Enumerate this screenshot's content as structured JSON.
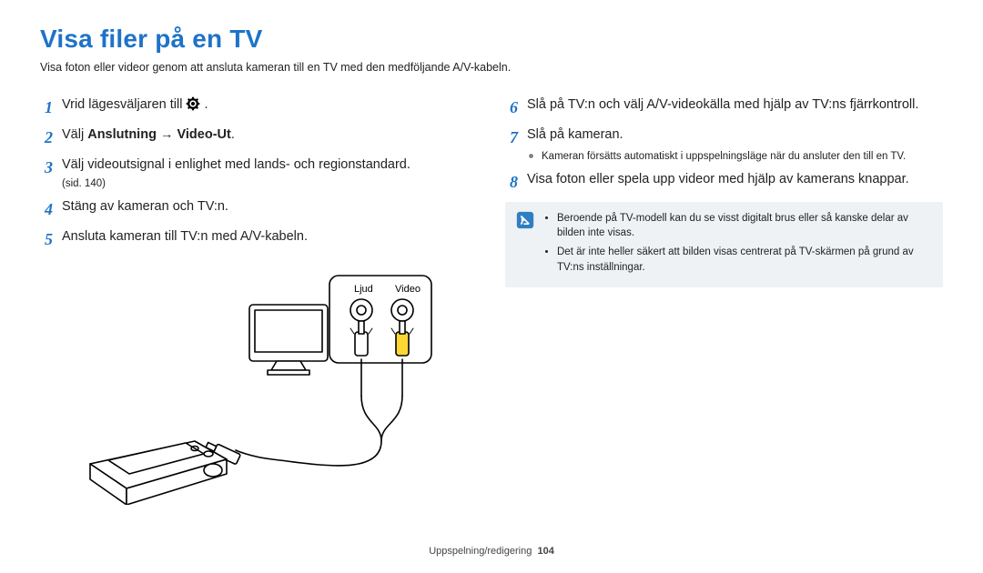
{
  "title": "Visa filer på en TV",
  "intro": "Visa foton eller videor genom att ansluta kameran till en TV med den medföljande A/V-kabeln.",
  "left_steps": [
    {
      "n": "1",
      "text": "Vrid lägesväljaren till ",
      "icon": "gear",
      "after": " ."
    },
    {
      "n": "2",
      "pre": "Välj ",
      "bold": "Anslutning → Video-Ut",
      "post": "."
    },
    {
      "n": "3",
      "text": "Välj videoutsignal i enlighet med lands- och regionstandard.",
      "sub": "(sid. 140)"
    },
    {
      "n": "4",
      "text": "Stäng av kameran och TV:n."
    },
    {
      "n": "5",
      "text": "Ansluta kameran till TV:n med A/V-kabeln."
    }
  ],
  "diagram": {
    "label_audio": "Ljud",
    "label_video": "Video"
  },
  "right_steps": [
    {
      "n": "6",
      "text": "Slå på TV:n och välj A/V-videokälla med hjälp av TV:ns fjärrkontroll."
    },
    {
      "n": "7",
      "text": "Slå på kameran.",
      "bullets": [
        "Kameran försätts automatiskt i uppspelningsläge när du ansluter den till en TV."
      ]
    },
    {
      "n": "8",
      "text": "Visa foton eller spela upp videor med hjälp av kamerans knappar."
    }
  ],
  "infobox": [
    "Beroende på TV-modell kan du se visst digitalt brus eller så kanske delar av bilden inte visas.",
    "Det är inte heller säkert att bilden visas centrerat på TV-skärmen på grund av TV:ns inställningar."
  ],
  "footer_section": "Uppspelning/redigering",
  "footer_page": "104"
}
